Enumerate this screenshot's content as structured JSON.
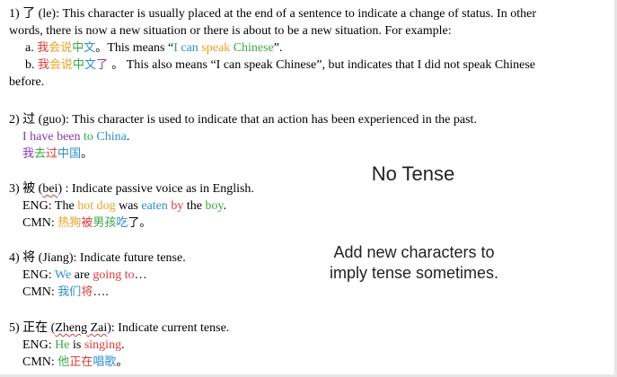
{
  "p1": {
    "line1": "1) 了 (le): This character is usually placed at the end of a sentence to indicate a change of status. In other",
    "line2": "words, there is now a new situation or there is about to be a new situation. For example:",
    "a_prefix": "a. ",
    "a_cn": [
      "我",
      "会",
      "说",
      "中",
      "文",
      "。"
    ],
    "a_text1": "This means “",
    "a_en": [
      "I",
      " can",
      " speak",
      " Chinese"
    ],
    "a_text2": "”.",
    "b_prefix": "b. ",
    "b_cn": [
      "我",
      "会",
      "说",
      "中",
      "文",
      "了",
      " 。"
    ],
    "b_text": " This also means “I can speak Chinese”, but indicates that I did not speak Chinese",
    "line_last": "before."
  },
  "p2": {
    "line1": "2) 过 (guo): This character is used to indicate that an action has been experienced in the past.",
    "en": [
      "I have been",
      " to ",
      "China",
      "."
    ],
    "cn": [
      "我",
      "去",
      "过",
      "中",
      "国",
      "。"
    ]
  },
  "p3": {
    "head_a": "3) 被 (",
    "head_bei": "bei",
    "head_b": ") : Indicate passive voice as in English.",
    "eng_label": "ENG: ",
    "eng": [
      "The ",
      "hot dog",
      " was ",
      "eaten",
      " by",
      " the ",
      "boy",
      "."
    ],
    "cmn_label": "CMN: ",
    "cmn": [
      "热",
      "狗",
      "被",
      "男",
      "孩",
      "吃",
      "了",
      "。"
    ]
  },
  "p4": {
    "head": "4) 将 (Jiang): Indicate future tense.",
    "eng_label": "ENG: ",
    "eng": [
      "We",
      " are ",
      "going to",
      "…"
    ],
    "cmn_label": "CMN: ",
    "cmn": [
      "我们",
      "将",
      "…."
    ]
  },
  "p5": {
    "head_a": "5) 正在 (",
    "head_zz": "Zheng Zai",
    "head_b": "): Indicate current tense.",
    "eng_label": "ENG: ",
    "eng": [
      "He",
      " is ",
      "singing",
      "."
    ],
    "cmn_label": "CMN: ",
    "cmn": [
      "他",
      "正",
      "在",
      "唱",
      "歌",
      "。"
    ]
  },
  "side": {
    "title": "No Tense",
    "note_line1": "Add new characters to",
    "note_line2": "imply tense sometimes."
  }
}
